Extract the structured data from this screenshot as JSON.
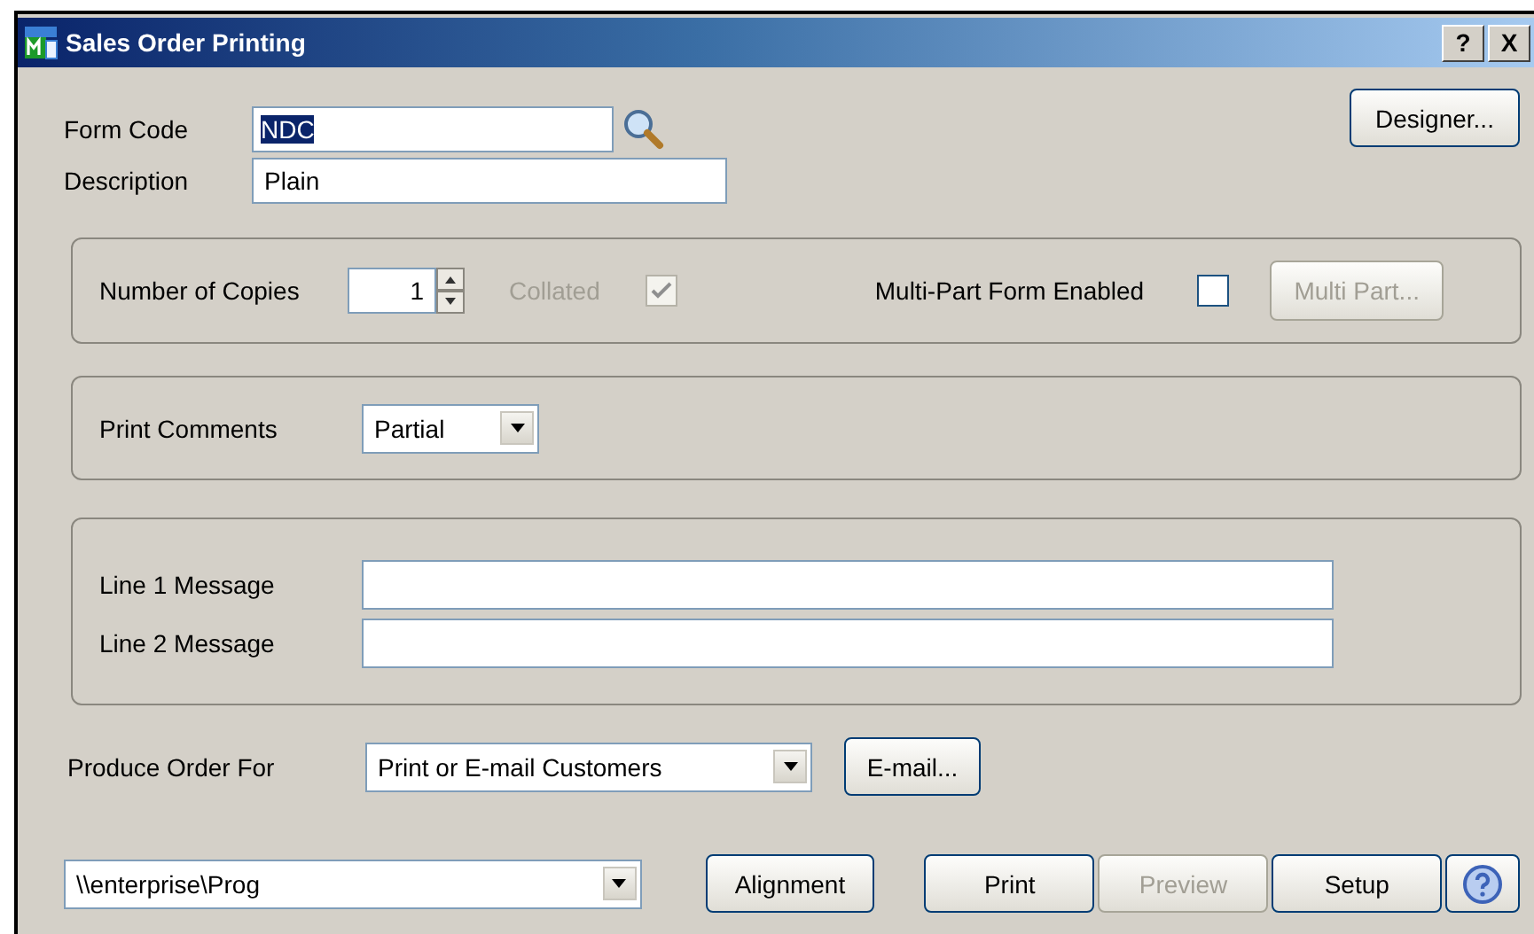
{
  "window": {
    "title": "Sales Order Printing",
    "title_buttons": [
      "?",
      "X"
    ]
  },
  "form_code": {
    "label": "Form Code",
    "value": "NDC",
    "selected_text": true
  },
  "description": {
    "label": "Description",
    "value": "Plain"
  },
  "designer_button": {
    "label": "Designer...",
    "disabled": false
  },
  "copies": {
    "label": "Number of Copies",
    "value": "1",
    "collated": {
      "label": "Collated",
      "checked": true,
      "disabled": true
    },
    "multi_part": {
      "label": "Multi-Part Form Enabled",
      "checked": false,
      "disabled": false
    },
    "multi_part_button": {
      "label": "Multi Part...",
      "disabled": true
    }
  },
  "print_comments": {
    "label": "Print Comments",
    "value": "Partial"
  },
  "messages": [
    {
      "label": "Line 1 Message"
    },
    {
      "label": "Line 2 Message"
    }
  ],
  "produce_order_for": {
    "label": "Produce Order For",
    "value": "Print or E-mail Customers"
  },
  "email_button": {
    "label": "E-mail...",
    "disabled": false
  },
  "printer": {
    "value": "\\\\enterprise\\Prog"
  },
  "buttons": [
    {
      "label": "Alignment",
      "disabled": false,
      "kind": "text"
    },
    {
      "label": "Print",
      "disabled": false,
      "kind": "text"
    },
    {
      "label": "Preview",
      "disabled": true,
      "kind": "text"
    },
    {
      "label": "Setup",
      "disabled": false,
      "kind": "text"
    },
    {
      "kind": "help",
      "disabled": false
    }
  ]
}
